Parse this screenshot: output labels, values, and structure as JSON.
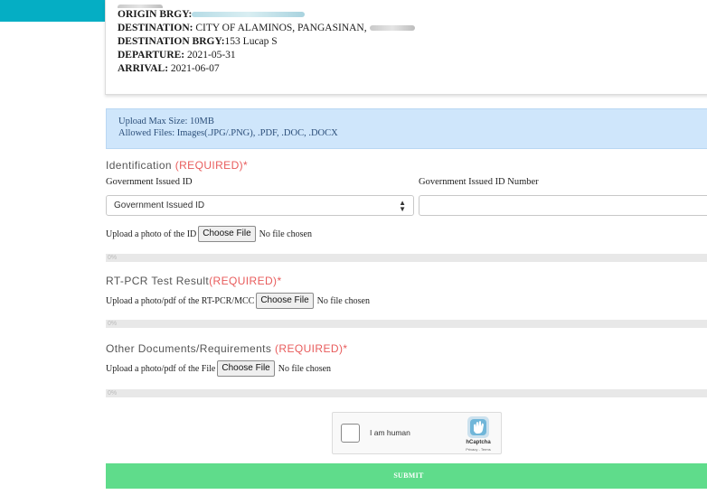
{
  "trip": {
    "origin_brgy_key": "ORIGIN BRGY:",
    "destination_key": "DESTINATION:",
    "destination_value": "CITY OF ALAMINOS, PANGASINAN,",
    "destination_brgy_key": "DESTINATION BRGY:",
    "destination_brgy_value": "153 Lucap S",
    "departure_key": "DEPARTURE:",
    "departure_value": "2021-05-31",
    "arrival_key": "ARRIVAL:",
    "arrival_value": "2021-06-07"
  },
  "upload_info": {
    "max_size": "Upload Max Size: 10MB",
    "allowed": "Allowed Files: Images(.JPG/.PNG), .PDF, .DOC, .DOCX"
  },
  "identification": {
    "title": "Identification ",
    "required": "(REQUIRED)*",
    "id_label": "Government Issued ID",
    "id_number_label": "Government Issued ID Number",
    "select_value": "Government Issued ID",
    "upload_prompt": "Upload a photo of the ID",
    "choose_file": "Choose File",
    "no_file": "No file chosen",
    "progress_text": "0%"
  },
  "rtpcr": {
    "title": "RT-PCR Test Result",
    "required": "(REQUIRED)*",
    "upload_prompt": "Upload a photo/pdf of the RT-PCR/MCC",
    "choose_file": "Choose File",
    "no_file": "No file chosen",
    "progress_text": "0%"
  },
  "other_docs": {
    "title": "Other Documents/Requirements ",
    "required": "(REQUIRED)*",
    "upload_prompt": "Upload a photo/pdf of the File",
    "choose_file": "Choose File",
    "no_file": "No file chosen",
    "progress_text": "0%"
  },
  "captcha": {
    "label": "I am human",
    "brand": "hCaptcha",
    "terms": "Privacy - Terms"
  },
  "submit_label": "SUBMIT",
  "colors": {
    "topbar": "#05aec4",
    "required": "#e85c5c",
    "info_bg": "#cfe6fb",
    "submit_bg": "#5fdc8b"
  }
}
